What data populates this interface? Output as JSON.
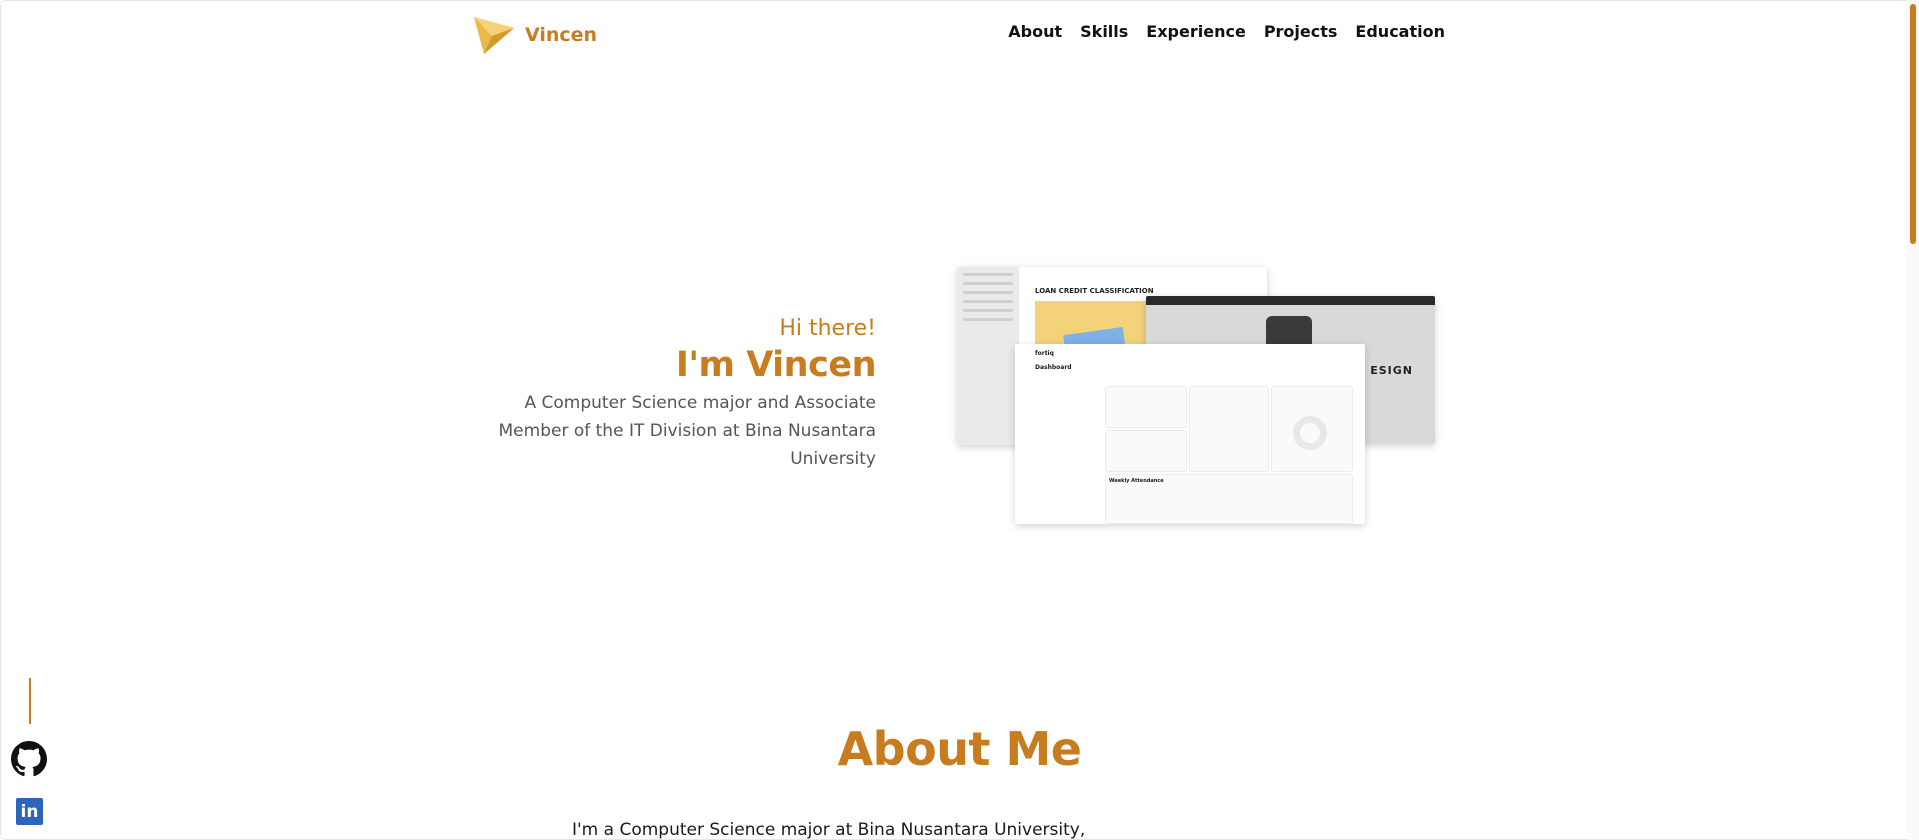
{
  "brand": {
    "name": "Vincen",
    "logo_icon": "paper-plane-icon",
    "accent": "#c77d1f"
  },
  "nav": {
    "items": [
      {
        "label": "About"
      },
      {
        "label": "Skills"
      },
      {
        "label": "Experience"
      },
      {
        "label": "Projects"
      },
      {
        "label": "Education"
      }
    ]
  },
  "hero": {
    "greeting": "Hi there!",
    "headline": "I'm Vincen",
    "description": "A Computer Science major and Associate Member of the IT Division at Bina Nusantara University"
  },
  "projects_preview": {
    "card1_title": "LOAN CREDIT CLASSIFICATION",
    "card2_word": "ESIGN",
    "card3_title": "Dashboard",
    "card3_brand": "fortiq",
    "card3_section": "Weekly Attendance"
  },
  "about": {
    "title": "About Me",
    "body": "I'm a Computer Science major at Bina Nusantara University,"
  },
  "social": {
    "github_icon": "github-icon",
    "linkedin_icon": "linkedin-icon",
    "linkedin_text": "in"
  },
  "colors": {
    "accent": "#c77d1f",
    "text": "#1a1a1a",
    "muted": "#555555"
  }
}
